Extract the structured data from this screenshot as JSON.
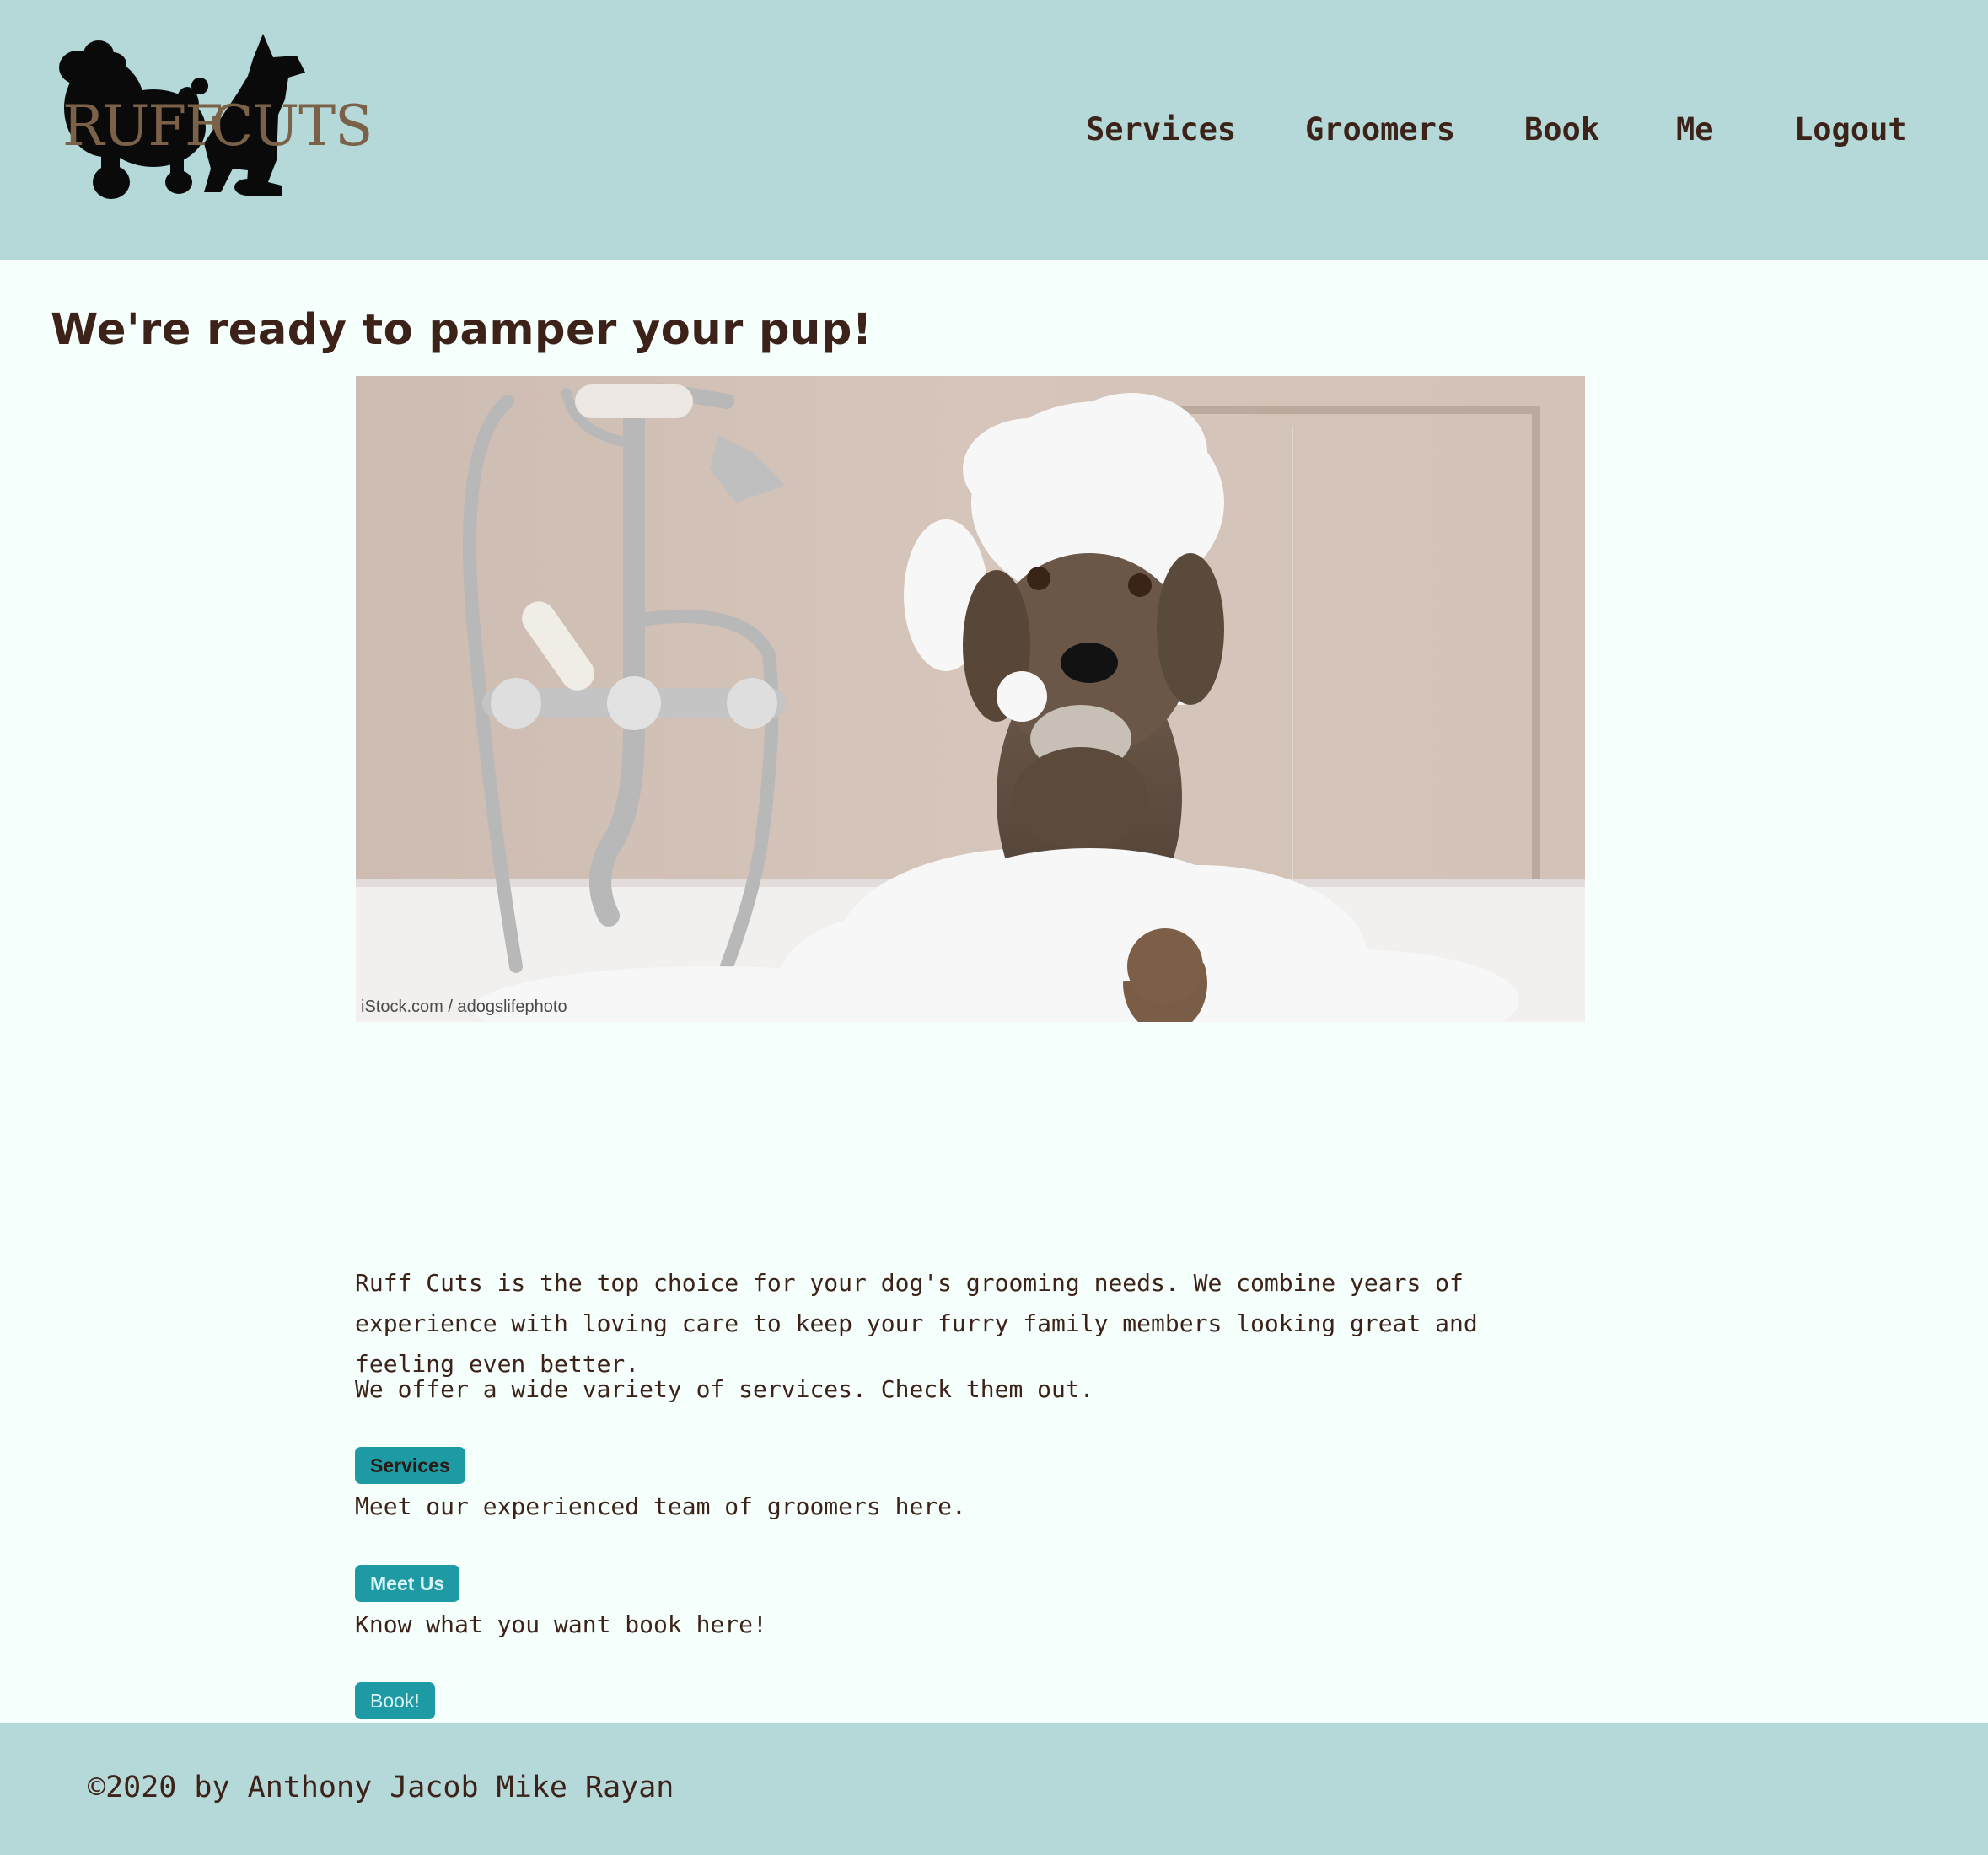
{
  "brand": {
    "logo_text_primary": "RUFF",
    "logo_text_secondary": "CUTS",
    "logo_color": "#7a6148"
  },
  "nav": {
    "items": [
      {
        "label": "Services"
      },
      {
        "label": "Groomers"
      },
      {
        "label": "Book"
      },
      {
        "label": "Me"
      },
      {
        "label": "Logout"
      }
    ]
  },
  "main": {
    "title": "We're ready to pamper your pup!",
    "hero_credit": "iStock.com / adogslifephoto",
    "intro": "Ruff Cuts is the top choice for your dog's grooming needs. We combine years of experience with loving care to keep your furry family members looking great and feeling even better.",
    "services_text": "We offer a wide variety of services. Check them out.",
    "services_button": "Services",
    "team_text": "Meet our experienced team of groomers here.",
    "team_button": "Meet Us",
    "book_text": "Know what you want book here!",
    "book_button": "Book!"
  },
  "footer": {
    "copyright": "©2020 by Anthony Jacob Mike Rayan"
  },
  "colors": {
    "header_bg": "#b5d9d8",
    "page_bg": "#f5fffb",
    "text": "#3c2218",
    "button_bg": "#1e9aa5"
  }
}
